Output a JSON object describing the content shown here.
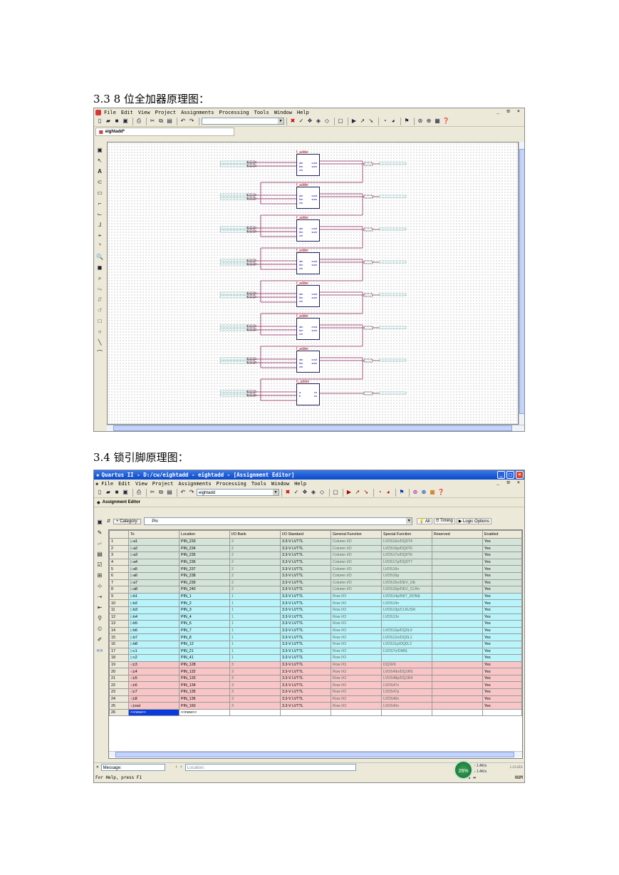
{
  "heading1": "3.3 8 位全加器原理图：",
  "heading2": "3.4  锁引脚原理图：",
  "schematic": {
    "menu": [
      "File",
      "Edit",
      "View",
      "Project",
      "Assignments",
      "Processing",
      "Tools",
      "Window",
      "Help"
    ],
    "window_controls": "_ ⊡ ×",
    "doc_tab": "eightadd*",
    "blocks": [
      {
        "name": "f_adder",
        "pins_left": [
          "ain",
          "bin",
          "cin"
        ],
        "pins_right": [
          "cout",
          "sum"
        ]
      },
      {
        "name": "f_adder",
        "pins_left": [
          "ain",
          "bin",
          "cin"
        ],
        "pins_right": [
          "cout",
          "sum"
        ]
      },
      {
        "name": "f_adder",
        "pins_left": [
          "ain",
          "bin",
          "cin"
        ],
        "pins_right": [
          "cout",
          "sum"
        ]
      },
      {
        "name": "f_adder",
        "pins_left": [
          "ain",
          "bin",
          "cin"
        ],
        "pins_right": [
          "cout",
          "sum"
        ]
      },
      {
        "name": "f_adder",
        "pins_left": [
          "ain",
          "bin",
          "cin"
        ],
        "pins_right": [
          "cout",
          "sum"
        ]
      },
      {
        "name": "f_adder",
        "pins_left": [
          "ain",
          "bin",
          "cin"
        ],
        "pins_right": [
          "cout",
          "sum"
        ]
      },
      {
        "name": "f_adder",
        "pins_left": [
          "ain",
          "bin",
          "cin"
        ],
        "pins_right": [
          "cout",
          "sum"
        ]
      },
      {
        "name": "h_adder",
        "pins_left": [
          "a",
          "b"
        ],
        "pins_right": [
          "co",
          "so"
        ]
      }
    ]
  },
  "assignment": {
    "title": "Quartus II - D:/cw/eightadd - eightadd - [Assignment Editor]",
    "menu": [
      "File",
      "Edit",
      "View",
      "Project",
      "Assignments",
      "Processing",
      "Tools",
      "Window",
      "Help"
    ],
    "window_controls": "_ ⊡ ×",
    "project_combo": "eightadd",
    "panel_title": "Assignment Editor",
    "category_label": "Category:",
    "category_value": "Pin",
    "btn_all": "All",
    "btn_timing": "Timing",
    "btn_logic": "Logic Options",
    "columns": [
      "To",
      "Location",
      "I/O Bank",
      "I/O Standard",
      "General Function",
      "Special Function",
      "Reserved",
      "Enabled"
    ],
    "rows": [
      {
        "n": "1",
        "to": "a1",
        "loc": "PIN_233",
        "bank": "2",
        "std": "3.3-V LVTTL",
        "gen": "Column I/O",
        "spec": "LVDS16n/DQ0T4",
        "res": "",
        "en": "Yes",
        "grp": "a"
      },
      {
        "n": "2",
        "to": "a2",
        "loc": "PIN_234",
        "bank": "2",
        "std": "3.3-V LVTTL",
        "gen": "Column I/O",
        "spec": "LVDS16p/DQ0T6",
        "res": "",
        "en": "Yes",
        "grp": "a"
      },
      {
        "n": "3",
        "to": "a3",
        "loc": "PIN_235",
        "bank": "2",
        "std": "3.3-V LVTTL",
        "gen": "Column I/O",
        "spec": "LVDS17n/DQ0T6",
        "res": "",
        "en": "Yes",
        "grp": "a"
      },
      {
        "n": "4",
        "to": "a4",
        "loc": "PIN_236",
        "bank": "2",
        "std": "3.3-V LVTTL",
        "gen": "Column I/O",
        "spec": "LVDS17p/DQ0T7",
        "res": "",
        "en": "Yes",
        "grp": "a"
      },
      {
        "n": "5",
        "to": "a5",
        "loc": "PIN_237",
        "bank": "2",
        "std": "3.3-V LVTTL",
        "gen": "Column I/O",
        "spec": "LVDS16n",
        "res": "",
        "en": "Yes",
        "grp": "a"
      },
      {
        "n": "6",
        "to": "a6",
        "loc": "PIN_238",
        "bank": "2",
        "std": "3.3-V LVTTL",
        "gen": "Column I/O",
        "spec": "LVDS16p",
        "res": "",
        "en": "Yes",
        "grp": "a"
      },
      {
        "n": "7",
        "to": "a7",
        "loc": "PIN_239",
        "bank": "2",
        "std": "3.3-V LVTTL",
        "gen": "Column I/O",
        "spec": "LVDS15n/DEV_OE",
        "res": "",
        "en": "Yes",
        "grp": "a"
      },
      {
        "n": "8",
        "to": "a8",
        "loc": "PIN_240",
        "bank": "2",
        "std": "3.3-V LVTTL",
        "gen": "Column I/O",
        "spec": "LVDS15p/DEV_CLRn",
        "res": "",
        "en": "Yes",
        "grp": "a"
      },
      {
        "n": "9",
        "to": "b1",
        "loc": "PIN_1",
        "bank": "1",
        "std": "3.3-V LVTTL",
        "gen": "Row I/O",
        "spec": "LVDS14p/INIT_DONE",
        "res": "",
        "en": "Yes",
        "grp": "b"
      },
      {
        "n": "10",
        "to": "b2",
        "loc": "PIN_2",
        "bank": "1",
        "std": "3.3-V LVTTL",
        "gen": "Row I/O",
        "spec": "LVDS14n",
        "res": "",
        "en": "Yes",
        "grp": "b"
      },
      {
        "n": "11",
        "to": "b3",
        "loc": "PIN_3",
        "bank": "1",
        "std": "3.3-V LVTTL",
        "gen": "Row I/O",
        "spec": "LVDS13p/CLKUSR",
        "res": "",
        "en": "Yes",
        "grp": "b"
      },
      {
        "n": "12",
        "to": "b4",
        "loc": "PIN_4",
        "bank": "1",
        "std": "3.3-V LVTTL",
        "gen": "Row I/O",
        "spec": "LVDS13n",
        "res": "",
        "en": "Yes",
        "grp": "b"
      },
      {
        "n": "13",
        "to": "b5",
        "loc": "PIN_6",
        "bank": "1",
        "std": "3.3-V LVTTL",
        "gen": "Row I/O",
        "spec": "",
        "res": "",
        "en": "Yes",
        "grp": "b"
      },
      {
        "n": "14",
        "to": "b6",
        "loc": "PIN_7",
        "bank": "1",
        "std": "3.3-V LVTTL",
        "gen": "Row I/O",
        "spec": "LVDS12p/DQ0L0",
        "res": "",
        "en": "Yes",
        "grp": "b"
      },
      {
        "n": "15",
        "to": "b7",
        "loc": "PIN_8",
        "bank": "1",
        "std": "3.3-V LVTTL",
        "gen": "Row I/O",
        "spec": "LVDS12n/DQ0L1",
        "res": "",
        "en": "Yes",
        "grp": "b"
      },
      {
        "n": "16",
        "to": "b8",
        "loc": "PIN_12",
        "bank": "1",
        "std": "3.3-V LVTTL",
        "gen": "Row I/O",
        "spec": "LVDS11p/DQ0L2",
        "res": "",
        "en": "Yes",
        "grp": "b"
      },
      {
        "n": "17",
        "to": "c1",
        "loc": "PIN_21",
        "bank": "1",
        "std": "3.3-V LVTTL",
        "gen": "Row I/O",
        "spec": "LVDS7n/DM0L",
        "res": "",
        "en": "Yes",
        "grp": "b"
      },
      {
        "n": "18",
        "to": "c2",
        "loc": "PIN_41",
        "bank": "1",
        "std": "3.3-V LVTTL",
        "gen": "Row I/O",
        "spec": "",
        "res": "",
        "en": "Yes",
        "grp": "b"
      },
      {
        "n": "19",
        "to": "c3",
        "loc": "PIN_128",
        "bank": "3",
        "std": "3.3-V LVTTL",
        "gen": "Row I/O",
        "spec": "DQ1R6",
        "res": "",
        "en": "Yes",
        "grp": "c"
      },
      {
        "n": "20",
        "to": "c4",
        "loc": "PIN_132",
        "bank": "3",
        "std": "3.3-V LVTTL",
        "gen": "Row I/O",
        "spec": "LVDS49n/DQ1R5",
        "res": "",
        "en": "Yes",
        "grp": "c"
      },
      {
        "n": "21",
        "to": "c5",
        "loc": "PIN_133",
        "bank": "3",
        "std": "3.3-V LVTTL",
        "gen": "Row I/O",
        "spec": "LVDS48p/DQ1R4",
        "res": "",
        "en": "Yes",
        "grp": "c"
      },
      {
        "n": "22",
        "to": "c6",
        "loc": "PIN_134",
        "bank": "3",
        "std": "3.3-V LVTTL",
        "gen": "Row I/O",
        "spec": "LVDS47n",
        "res": "",
        "en": "Yes",
        "grp": "c"
      },
      {
        "n": "23",
        "to": "c7",
        "loc": "PIN_135",
        "bank": "3",
        "std": "3.3-V LVTTL",
        "gen": "Row I/O",
        "spec": "LVDS47p",
        "res": "",
        "en": "Yes",
        "grp": "c"
      },
      {
        "n": "24",
        "to": "c8",
        "loc": "PIN_136",
        "bank": "3",
        "std": "3.3-V LVTTL",
        "gen": "Row I/O",
        "spec": "LVDS46n",
        "res": "",
        "en": "Yes",
        "grp": "c"
      },
      {
        "n": "25",
        "to": "cout",
        "loc": "PIN_160",
        "bank": "3",
        "std": "3.3-V LVTTL",
        "gen": "Row I/O",
        "spec": "LVDS42n",
        "res": "",
        "en": "Yes",
        "grp": "c"
      },
      {
        "n": "26",
        "to": "<<new>>",
        "loc": "<<new>>",
        "bank": "",
        "std": "",
        "gen": "",
        "spec": "",
        "res": "",
        "en": "",
        "grp": "new"
      }
    ],
    "message_label": "Message:",
    "location_label": "Location:",
    "location_right": "Locate",
    "status_help": "For Help, press F1",
    "cpu_percent": "26%",
    "net_up": "1.4K/s",
    "net_down": "1.4K/s",
    "num": "NUM",
    "colors": {
      "a": "#d4e4d8",
      "b": "#b8f4fa",
      "c": "#f8c6c6",
      "new": "#ffffff",
      "select": "#0a3cdc"
    }
  }
}
